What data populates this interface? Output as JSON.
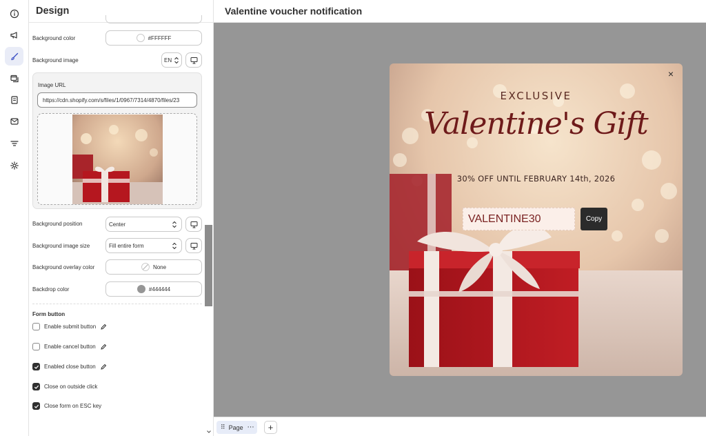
{
  "rail": {
    "items": [
      {
        "icon": "info-icon",
        "active": false
      },
      {
        "icon": "megaphone-icon",
        "active": false
      },
      {
        "icon": "brush-icon",
        "active": true
      },
      {
        "icon": "browser-windows-icon",
        "active": false
      },
      {
        "icon": "form-icon",
        "active": false
      },
      {
        "icon": "email-icon",
        "active": false
      },
      {
        "icon": "filter-icon",
        "active": false
      },
      {
        "icon": "gear-icon",
        "active": false
      }
    ]
  },
  "panel": {
    "title": "Design",
    "background_color": {
      "label": "Background color",
      "value": "#FFFFFF"
    },
    "background_image": {
      "label": "Background image",
      "locale": "EN"
    },
    "image_url": {
      "label": "Image URL",
      "value": "https://cdn.shopify.com/s/files/1/0967/7314/4870/files/23"
    },
    "background_position": {
      "label": "Background position",
      "value": "Center"
    },
    "background_image_size": {
      "label": "Background image size",
      "value": "Fill entire form"
    },
    "background_overlay_color": {
      "label": "Background overlay color",
      "value": "None"
    },
    "backdrop_color": {
      "label": "Backdrop color",
      "value": "#444444"
    },
    "form_button": {
      "title": "Form button",
      "options": [
        {
          "label": "Enable submit button",
          "checked": false,
          "editable": true
        },
        {
          "label": "Enable cancel button",
          "checked": false,
          "editable": true
        },
        {
          "label": "Enabled close button",
          "checked": true,
          "editable": true
        },
        {
          "label": "Close on outside click",
          "checked": true,
          "editable": false
        },
        {
          "label": "Close form on ESC key",
          "checked": true,
          "editable": false
        }
      ]
    }
  },
  "canvas": {
    "title": "Valentine voucher notification",
    "backdrop_color": "#969696",
    "page_tab": "Page",
    "popup": {
      "eyebrow": "EXCLUSIVE",
      "headline": "Valentine's Gift",
      "offer": "30% OFF UNTIL FEBRUARY 14th, 2026",
      "code": "VALENTINE30",
      "copy_label": "Copy",
      "close_symbol": "×"
    }
  }
}
